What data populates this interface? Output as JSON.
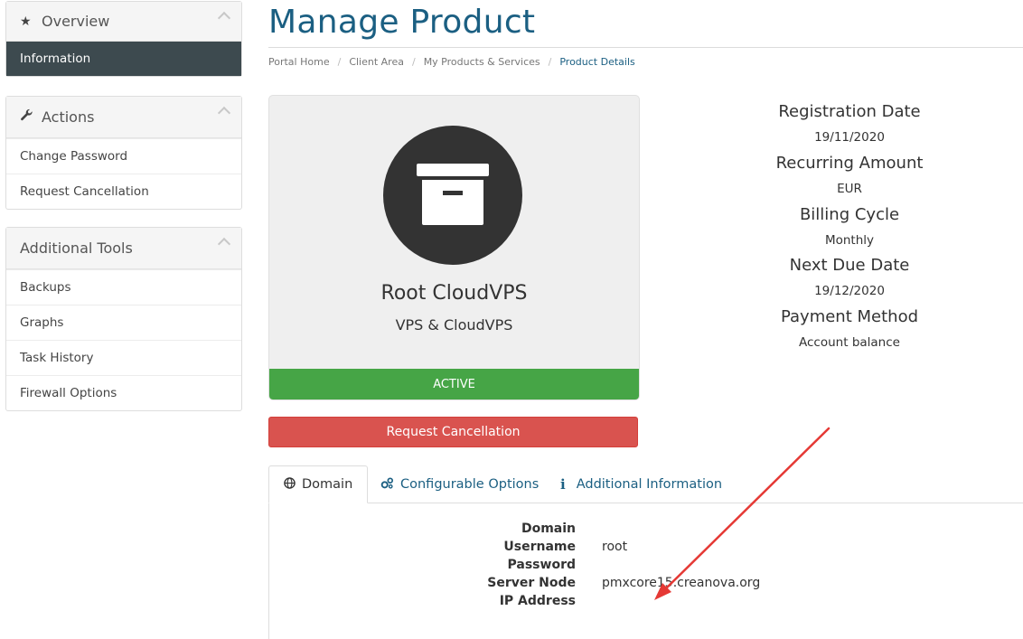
{
  "sidebar": {
    "overview": {
      "title": "Overview",
      "items": [
        "Information"
      ]
    },
    "actions": {
      "title": "Actions",
      "items": [
        "Change Password",
        "Request Cancellation"
      ]
    },
    "tools": {
      "title": "Additional Tools",
      "items": [
        "Backups",
        "Graphs",
        "Task History",
        "Firewall Options"
      ]
    }
  },
  "page": {
    "title": "Manage Product"
  },
  "breadcrumb": [
    "Portal Home",
    "Client Area",
    "My Products & Services",
    "Product Details"
  ],
  "product": {
    "name": "Root CloudVPS",
    "group": "VPS & CloudVPS",
    "status": "ACTIVE",
    "icon": "archive-box-icon"
  },
  "details": [
    {
      "label": "Registration Date",
      "value": "19/11/2020"
    },
    {
      "label": "Recurring Amount",
      "value": "EUR"
    },
    {
      "label": "Billing Cycle",
      "value": "Monthly"
    },
    {
      "label": "Next Due Date",
      "value": "19/12/2020"
    },
    {
      "label": "Payment Method",
      "value": "Account balance"
    }
  ],
  "cancel_button": "Request Cancellation",
  "tabs": [
    "Domain",
    "Configurable Options",
    "Additional Information"
  ],
  "domain_info": {
    "domain_label": "Domain",
    "domain_value": "",
    "username_label": "Username",
    "username_value": "root",
    "password_label": "Password",
    "password_value": "",
    "server_label": "Server Node",
    "server_value": "pmxcore15.creanova.org",
    "ip_label": "IP Address",
    "ip_value": ""
  },
  "colors": {
    "title": "#1b5f82",
    "active_status": "#46a546",
    "cancel": "#d9534f",
    "sidebar_active": "#3d4a4f",
    "annotation_arrow": "#e53935"
  }
}
